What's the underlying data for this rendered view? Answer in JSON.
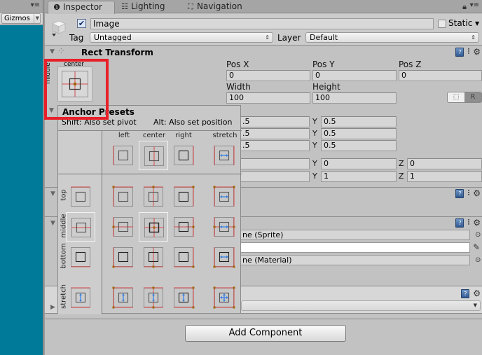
{
  "scene": {
    "gizmos_label": "Gizmos"
  },
  "tabs": [
    {
      "label": "Inspector",
      "icon": "info-icon",
      "glyph": "❶",
      "active": true
    },
    {
      "label": "Lighting",
      "icon": "lighting-icon",
      "glyph": "☷",
      "active": false
    },
    {
      "label": "Navigation",
      "icon": "navigation-icon",
      "glyph": "⛶",
      "active": false
    }
  ],
  "header": {
    "active": true,
    "name": "Image",
    "static_label": "Static",
    "static": false,
    "tag_label": "Tag",
    "tag_value": "Untagged",
    "layer_label": "Layer",
    "layer_value": "Default"
  },
  "rect_transform": {
    "title": "Rect Transform",
    "anchor_h": "center",
    "anchor_v": "middle",
    "pos_x_label": "Pos X",
    "pos_y_label": "Pos Y",
    "pos_z_label": "Pos Z",
    "pos_x": "0",
    "pos_y": "0",
    "pos_z": "0",
    "width_label": "Width",
    "height_label": "Height",
    "width": "100",
    "height": "100",
    "raw_label": "R",
    "anchor_min_x": ".5",
    "anchor_min_y": "0.5",
    "anchor_max_x": ".5",
    "anchor_max_y": "0.5",
    "pivot_x": ".5",
    "pivot_y": "0.5",
    "rotation_x": "",
    "rotation_y": "0",
    "rotation_z": "0",
    "scale_x": "",
    "scale_y": "1",
    "scale_z": "1",
    "y_axis": "Y",
    "z_axis": "Z"
  },
  "anchor_presets": {
    "title": "Anchor Presets",
    "shift_hint": "Shift: Also set pivot",
    "alt_hint": "Alt: Also set position",
    "columns": [
      "left",
      "center",
      "right",
      "stretch"
    ],
    "rows": [
      "top",
      "middle",
      "bottom",
      "stretch"
    ],
    "selected": {
      "row": "middle",
      "column": "center"
    }
  },
  "image": {
    "source_image": "None (Sprite)",
    "source_image_visible": "ne (Sprite)",
    "color": "#ffffff",
    "material": "None (Material)",
    "material_visible": "ne (Material)"
  },
  "footer": {
    "add_component_label": "Add Component"
  },
  "colors": {
    "scene_background": "#007a99",
    "highlight": "#e8202a",
    "anchor_line": "#d94a4a",
    "anchor_handle": "#a0660a",
    "stretch_arrow": "#3b82e0"
  }
}
